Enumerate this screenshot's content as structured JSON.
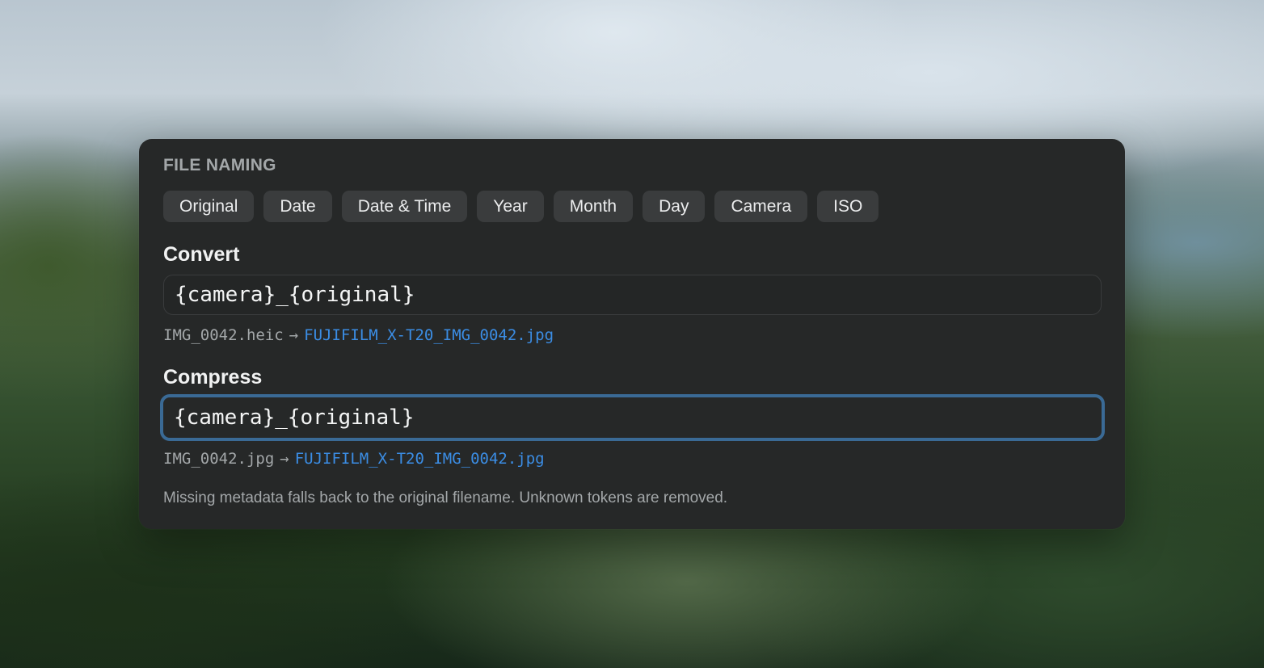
{
  "panel": {
    "title": "FILE NAMING"
  },
  "tokens": [
    {
      "label": "Original"
    },
    {
      "label": "Date"
    },
    {
      "label": "Date & Time"
    },
    {
      "label": "Year"
    },
    {
      "label": "Month"
    },
    {
      "label": "Day"
    },
    {
      "label": "Camera"
    },
    {
      "label": "ISO"
    }
  ],
  "convert": {
    "label": "Convert",
    "value": "{camera}_{original}",
    "preview_source": "IMG_0042.heic",
    "preview_arrow": "→",
    "preview_result": "FUJIFILM_X-T20_IMG_0042.jpg"
  },
  "compress": {
    "label": "Compress",
    "value": "{camera}_{original}",
    "focused": true,
    "preview_source": "IMG_0042.jpg",
    "preview_arrow": "→",
    "preview_result": "FUJIFILM_X-T20_IMG_0042.jpg"
  },
  "footnote": "Missing metadata falls back to the original filename. Unknown tokens are removed.",
  "colors": {
    "panel_bg": "#262828",
    "chip_bg": "#3a3c3d",
    "focus_ring": "#3a6a95",
    "result_link": "#3b8de4"
  }
}
